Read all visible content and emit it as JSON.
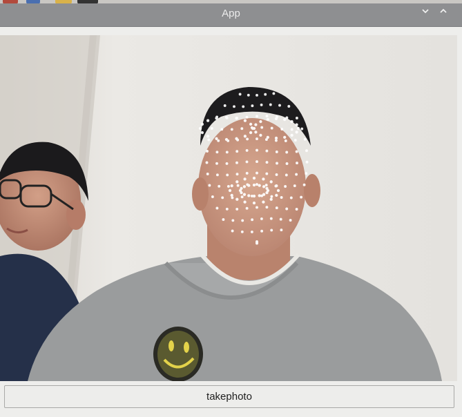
{
  "window": {
    "title": "App",
    "minimize_icon": "chevron-down-icon",
    "maximize_icon": "chevron-up-icon"
  },
  "camera": {
    "overlay": "face-mesh-landmarks",
    "mesh_color": "#ffffff"
  },
  "actions": {
    "take_photo_label": "takephoto"
  }
}
